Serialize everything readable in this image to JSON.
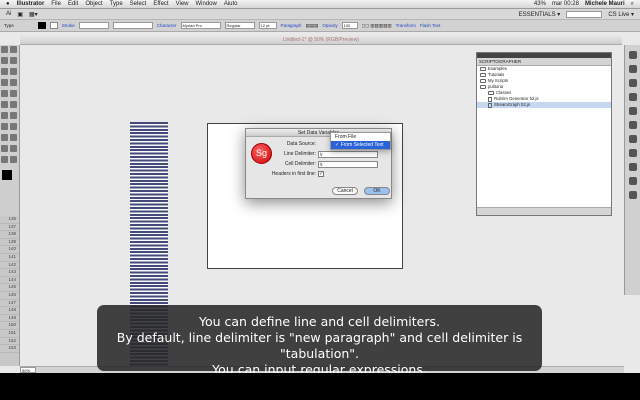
{
  "menubar": {
    "apple": "",
    "app": "Illustrator",
    "items": [
      "File",
      "Edit",
      "Object",
      "Type",
      "Select",
      "Effect",
      "View",
      "Window",
      "Aiuto"
    ],
    "battery": "43%",
    "clock": "mar 00:28",
    "user": "Michele Mauri"
  },
  "appbar": {
    "workspace": "ESSENTIALS ▾",
    "cslive": "CS Live ▾"
  },
  "control": {
    "type_label": "Type",
    "stroke": "Stroke",
    "character": "Character",
    "font": "Myriad Pro",
    "style": "Regular",
    "size": "12 pt",
    "paragraph": "Paragraph",
    "opacity": "Opacity",
    "opacity_val": "100",
    "transform": "Transform",
    "flash": "Flash Text"
  },
  "doc": {
    "title": "Untitled-1* @ 50% (RGB/Preview)"
  },
  "rows": [
    "136",
    "137",
    "138",
    "139",
    "140",
    "141",
    "142",
    "143",
    "144",
    "145",
    "146",
    "147",
    "148",
    "149",
    "150",
    "151",
    "152",
    "153"
  ],
  "dialog": {
    "title": "Set Data Variables",
    "logo": "Sg",
    "source_label": "Data Source:",
    "line_label": "Line Delimiter:",
    "line_val": "\\r",
    "cell_label": "Cell Delimiter:",
    "cell_val": "\\t",
    "headers_label": "Headers in first line:",
    "cancel": "Cancel",
    "ok": "OK"
  },
  "dropdown": {
    "options": [
      "From File",
      "✓ From Selected Text"
    ]
  },
  "panel": {
    "title": "SCRIPTOGRAPHER",
    "items": [
      {
        "label": "Examples",
        "kind": "folder",
        "depth": 0
      },
      {
        "label": "Tutorials",
        "kind": "folder",
        "depth": 0
      },
      {
        "label": "My Scripts",
        "kind": "folder",
        "depth": 0
      },
      {
        "label": "pulitoria",
        "kind": "folder",
        "depth": 0
      },
      {
        "label": "Classes",
        "kind": "folder",
        "depth": 1
      },
      {
        "label": "Rubrim Generator b2.js",
        "kind": "file",
        "depth": 1
      },
      {
        "label": "StreamGraph b3.js",
        "kind": "file",
        "depth": 1
      }
    ]
  },
  "status": {
    "zoom": "50%"
  },
  "caption": {
    "lines": [
      "You can define line and cell delimiters.",
      "By default, line delimiter is \"new paragraph\" and cell delimiter is \"tabulation\".",
      "You can input regular expressions."
    ]
  }
}
